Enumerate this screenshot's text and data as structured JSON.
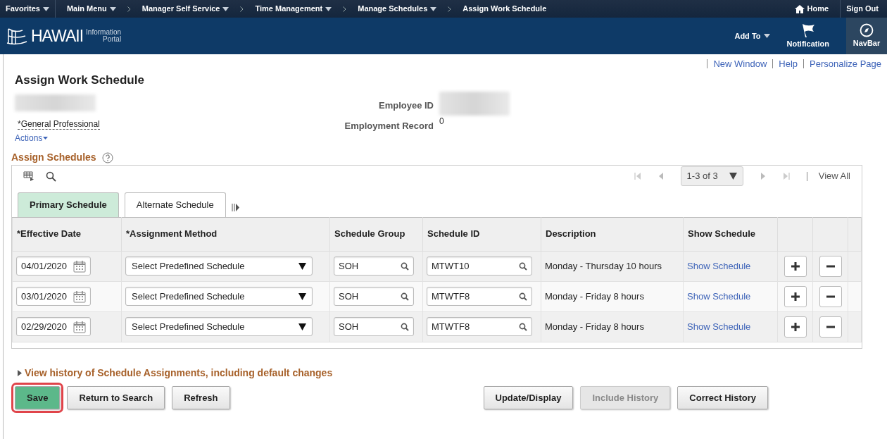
{
  "breadcrumbs": {
    "favorites": "Favorites",
    "items": [
      {
        "label": "Main Menu",
        "dropdown": true
      },
      {
        "label": "Manager Self Service",
        "dropdown": true
      },
      {
        "label": "Time Management",
        "dropdown": true
      },
      {
        "label": "Manage Schedules",
        "dropdown": true
      },
      {
        "label": "Assign Work Schedule",
        "dropdown": false
      }
    ]
  },
  "header_links": {
    "home": "Home",
    "sign_out": "Sign Out"
  },
  "logo": {
    "main": "HAWAII",
    "sub_top": "Information",
    "sub_bottom": "Portal"
  },
  "toolbar": {
    "add_to": "Add To",
    "notification": "Notification",
    "navbar": "NavBar"
  },
  "page_links": [
    "New Window",
    "Help",
    "Personalize Page"
  ],
  "page_title": "Assign Work Schedule",
  "employee": {
    "job_title": "*General Professional",
    "actions": "Actions",
    "employee_id_label": "Employee ID",
    "employment_record_label": "Employment Record",
    "employment_record": "0"
  },
  "section_title": "Assign Schedules",
  "grid": {
    "pager": "1-3 of 3",
    "view_all": "View All",
    "tabs": [
      {
        "label": "Primary Schedule",
        "selected": true
      },
      {
        "label": "Alternate Schedule",
        "selected": false
      }
    ],
    "columns": [
      "*Effective Date",
      "*Assignment Method",
      "Schedule Group",
      "Schedule ID",
      "Description",
      "Show Schedule"
    ],
    "rows": [
      {
        "effective_date": "04/01/2020",
        "assignment_method": "Select Predefined Schedule",
        "schedule_group": "SOH",
        "schedule_id": "MTWT10",
        "description": "Monday - Thursday 10 hours",
        "show_schedule": "Show Schedule"
      },
      {
        "effective_date": "03/01/2020",
        "assignment_method": "Select Predefined Schedule",
        "schedule_group": "SOH",
        "schedule_id": "MTWTF8",
        "description": "Monday - Friday 8 hours",
        "show_schedule": "Show Schedule"
      },
      {
        "effective_date": "02/29/2020",
        "assignment_method": "Select Predefined Schedule",
        "schedule_group": "SOH",
        "schedule_id": "MTWTF8",
        "description": "Monday - Friday 8 hours",
        "show_schedule": "Show Schedule"
      }
    ]
  },
  "history_link": "View history of Schedule Assignments, including default changes",
  "buttons": [
    {
      "label": "Save",
      "kind": "primary",
      "highlighted": true,
      "disabled": false
    },
    {
      "label": "Return to Search",
      "kind": "normal",
      "highlighted": false,
      "disabled": false
    },
    {
      "label": "Refresh",
      "kind": "normal",
      "highlighted": false,
      "disabled": false
    },
    {
      "label": "Update/Display",
      "kind": "normal",
      "highlighted": false,
      "disabled": false
    },
    {
      "label": "Include History",
      "kind": "normal",
      "highlighted": false,
      "disabled": true
    },
    {
      "label": "Correct History",
      "kind": "normal",
      "highlighted": false,
      "disabled": false
    }
  ]
}
